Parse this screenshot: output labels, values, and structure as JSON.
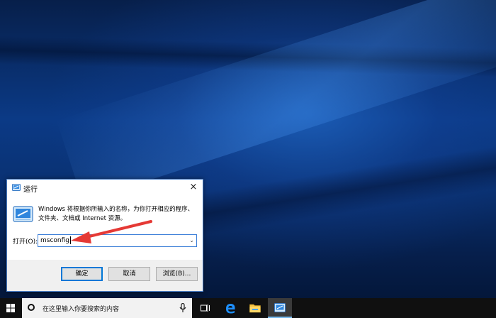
{
  "dialog": {
    "title": "运行",
    "close_glyph": "×",
    "description": "Windows 将根据你所输入的名称，为你打开相应的程序、文件夹、文档或 Internet 资源。",
    "open_label": "打开(O):",
    "input_value": "msconfig",
    "dropdown_glyph": "⌄",
    "ok_label": "确定",
    "cancel_label": "取消",
    "browse_label": "浏览(B)..."
  },
  "taskbar": {
    "search_placeholder": "在这里输入你要搜索的内容"
  },
  "colors": {
    "annotation_arrow": "#e53935",
    "accent": "#0078d7"
  },
  "icons": [
    "run-icon",
    "close-icon",
    "windows-logo-icon",
    "search-icon",
    "microphone-icon",
    "task-view-icon",
    "edge-icon",
    "file-explorer-icon",
    "run-app-icon"
  ]
}
